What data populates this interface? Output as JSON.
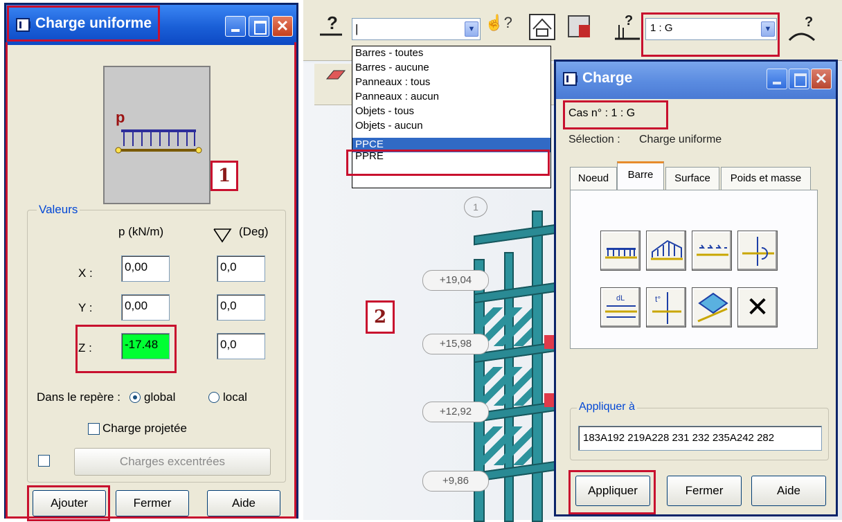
{
  "left_dialog": {
    "title": "Charge uniforme",
    "badge": "1",
    "preview_label": "p",
    "group_title": "Valeurs",
    "col_p": "p  (kN/m)",
    "col_deg": "(Deg)",
    "rows": [
      {
        "axis": "X :",
        "p": "0,00",
        "deg": "0,0"
      },
      {
        "axis": "Y :",
        "p": "0,00",
        "deg": "0,0"
      },
      {
        "axis": "Z :",
        "p": "-17.48",
        "deg": "0,0"
      }
    ],
    "repere_label": "Dans le repère :",
    "global_label": "global",
    "local_label": "local",
    "charge_projetee": "Charge projetée",
    "charges_excentrees": "Charges excentrées",
    "ajouter": "Ajouter",
    "fermer": "Fermer",
    "aide": "Aide",
    "highlight_color": "#00ff33"
  },
  "toolbar": {
    "combo1_value": "|",
    "case_combo_value": "1 : G"
  },
  "dropdown": {
    "items": [
      "Barres - toutes",
      "Barres - aucune",
      "Panneaux : tous",
      "Panneaux : aucun",
      "Objets - tous",
      "Objets - aucun",
      "PPCE",
      "PPRE"
    ],
    "selected_index": 6
  },
  "viewport": {
    "badge": "2",
    "elevations": [
      "+19,04",
      "+15,98",
      "+12,92",
      "+9,86"
    ],
    "axis_tag": "1"
  },
  "charge_dialog": {
    "title": "Charge",
    "case_label": "Cas n° : 1 : G",
    "selection_label": "Sélection :",
    "selection_value": "Charge uniforme",
    "tabs": [
      "Noeud",
      "Barre",
      "Surface",
      "Poids et masse"
    ],
    "active_tab": "Barre",
    "tool_icons": [
      "uniform-load-icon",
      "trapezoidal-load-icon",
      "point-forces-icon",
      "moment-load-icon",
      "thermal-load-icon",
      "point-load-icon",
      "surface-load-icon",
      "delete-load-icon"
    ],
    "appliquer_a_label": "Appliquer à",
    "appliquer_a_value": "183A192 219A228 231 232 235A242 282",
    "appliquer": "Appliquer",
    "fermer": "Fermer",
    "aide": "Aide"
  },
  "colors": {
    "highlight_red": "#c8102e",
    "xp_blue": "#0a246a",
    "structure_teal": "#2c929c"
  }
}
